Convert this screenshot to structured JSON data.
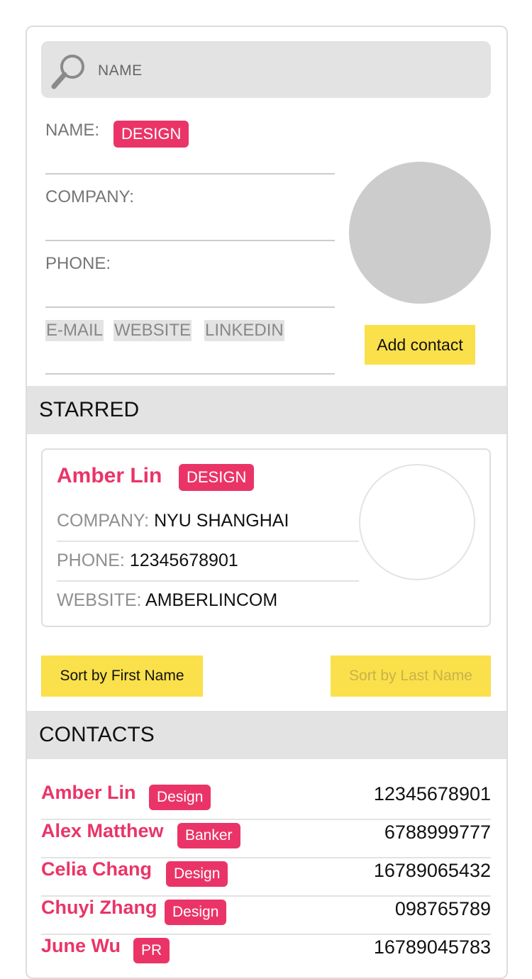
{
  "search": {
    "placeholder": "NAME"
  },
  "form": {
    "name_label": "NAME:",
    "tag": "DESIGN",
    "company_label": "COMPANY:",
    "phone_label": "PHONE:",
    "chips": [
      "E-MAIL",
      "WEBSITE",
      "LINKEDIN"
    ],
    "add_button": "Add contact"
  },
  "starred": {
    "header": "STARRED",
    "card": {
      "name": "Amber Lin",
      "tag": "DESIGN",
      "company_key": "COMPANY:",
      "company": "NYU SHANGHAI",
      "phone_key": "PHONE:",
      "phone": "12345678901",
      "website_key": "WEBSITE:",
      "website": "AMBERLINCOM"
    }
  },
  "sort": {
    "first": "Sort by First Name",
    "last": "Sort by Last Name"
  },
  "contacts": {
    "header": "CONTACTS",
    "items": [
      {
        "name": "Amber Lin",
        "tag": "Design",
        "phone": "12345678901"
      },
      {
        "name": "Alex Matthew",
        "tag": "Banker",
        "phone": "6788999777"
      },
      {
        "name": "Celia Chang",
        "tag": "Design",
        "phone": "16789065432"
      },
      {
        "name": "Chuyi Zhang",
        "tag": "Design",
        "phone": "098765789"
      },
      {
        "name": "June Wu",
        "tag": "PR",
        "phone": "16789045783"
      }
    ]
  },
  "colors": {
    "accent": "#ea3467",
    "button": "#fae04b",
    "panel": "#e3e3e3"
  }
}
